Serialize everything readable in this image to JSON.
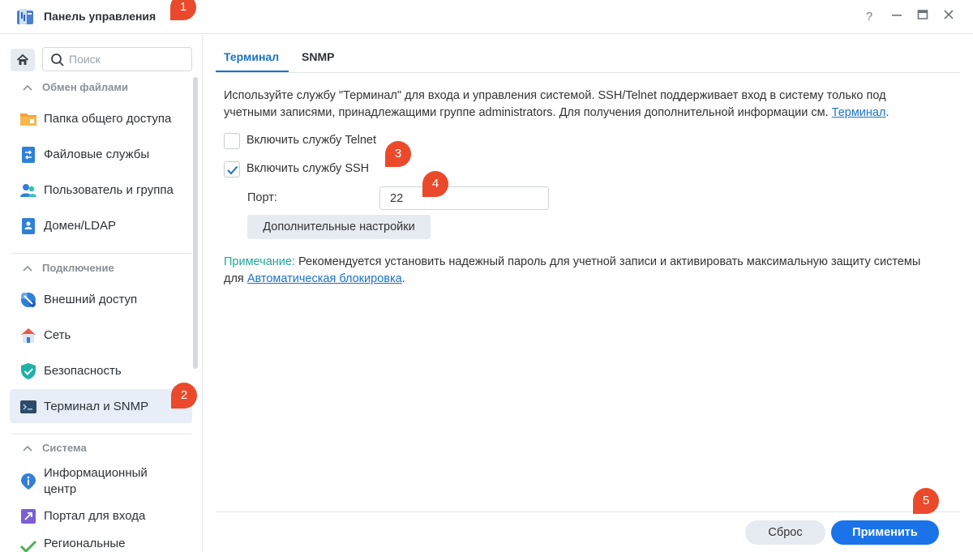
{
  "window": {
    "title": "Панель управления",
    "controls": {
      "help": "?",
      "minimize": "—",
      "maximize": "▭",
      "close": "✕"
    }
  },
  "markers": [
    "1",
    "2",
    "3",
    "4",
    "5"
  ],
  "sidebar": {
    "search_placeholder": "Поиск",
    "sections": [
      {
        "label": "Обмен файлами",
        "items": [
          {
            "label": "Папка общего доступа",
            "icon": "shared-folder-icon"
          },
          {
            "label": "Файловые службы",
            "icon": "file-services-icon"
          },
          {
            "label": "Пользователь и группа",
            "icon": "users-icon"
          },
          {
            "label": "Домен/LDAP",
            "icon": "domain-icon"
          }
        ]
      },
      {
        "label": "Подключение",
        "items": [
          {
            "label": "Внешний доступ",
            "icon": "external-access-icon"
          },
          {
            "label": "Сеть",
            "icon": "network-icon"
          },
          {
            "label": "Безопасность",
            "icon": "security-shield-icon"
          },
          {
            "label": "Терминал и SNMP",
            "icon": "terminal-icon",
            "active": true
          }
        ]
      },
      {
        "label": "Система",
        "items": [
          {
            "label": "Информационный центр",
            "line1": "Информационный",
            "line2": "центр",
            "icon": "info-center-icon"
          },
          {
            "label": "Портал для входа",
            "icon": "login-portal-icon"
          },
          {
            "label": "Региональные",
            "icon": "regional-icon"
          }
        ]
      }
    ]
  },
  "tabs": [
    {
      "label": "Терминал",
      "active": true
    },
    {
      "label": "SNMP",
      "active": false
    }
  ],
  "main": {
    "description": "Используйте службу \"Терминал\" для входа и управления системой. SSH/Telnet поддерживает вход в систему только под учетными записями, принадлежащими группе administrators. Для получения дополнительной информации см.",
    "description_link": "Терминал",
    "description_end": ".",
    "telnet_label": "Включить службу Telnet",
    "telnet_checked": false,
    "ssh_label": "Включить службу SSH",
    "ssh_checked": true,
    "port_label": "Порт:",
    "port_value": "22",
    "advanced_button": "Дополнительные настройки",
    "note_prefix": "Примечание:",
    "note_text": "Рекомендуется установить надежный пароль для учетной записи и активировать максимальную защиту системы для",
    "note_link": "Автоматическая блокировка",
    "note_end": "."
  },
  "footer": {
    "reset_button": "Сброс",
    "apply_button": "Применить"
  },
  "colors": {
    "accent": "#1a73c9",
    "apply_button": "#1a73e8",
    "marker": "#ea4a2b",
    "note_prefix": "#21a49a",
    "active_item_bg": "#e7eef7"
  }
}
